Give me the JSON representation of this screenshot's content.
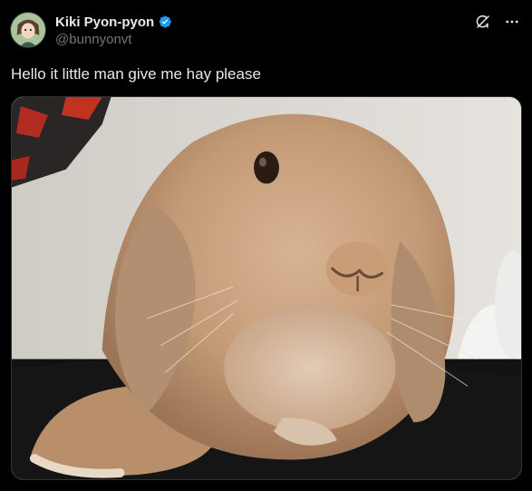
{
  "author": {
    "display_name": "Kiki Pyon-pyon",
    "handle": "@bunnyonvt",
    "verified": true,
    "avatar_icon": "anime-character-avatar"
  },
  "actions": {
    "grok_icon": "grok-icon",
    "more_icon": "more-icon"
  },
  "tweet": {
    "text": "Hello it little man give me hay please"
  },
  "media": {
    "type": "photo",
    "subject": "bunny-photo"
  },
  "colors": {
    "background": "#000000",
    "text_primary": "#e7e9ea",
    "text_secondary": "#71767b",
    "verified_blue": "#1d9bf0",
    "border": "#2f3336"
  }
}
